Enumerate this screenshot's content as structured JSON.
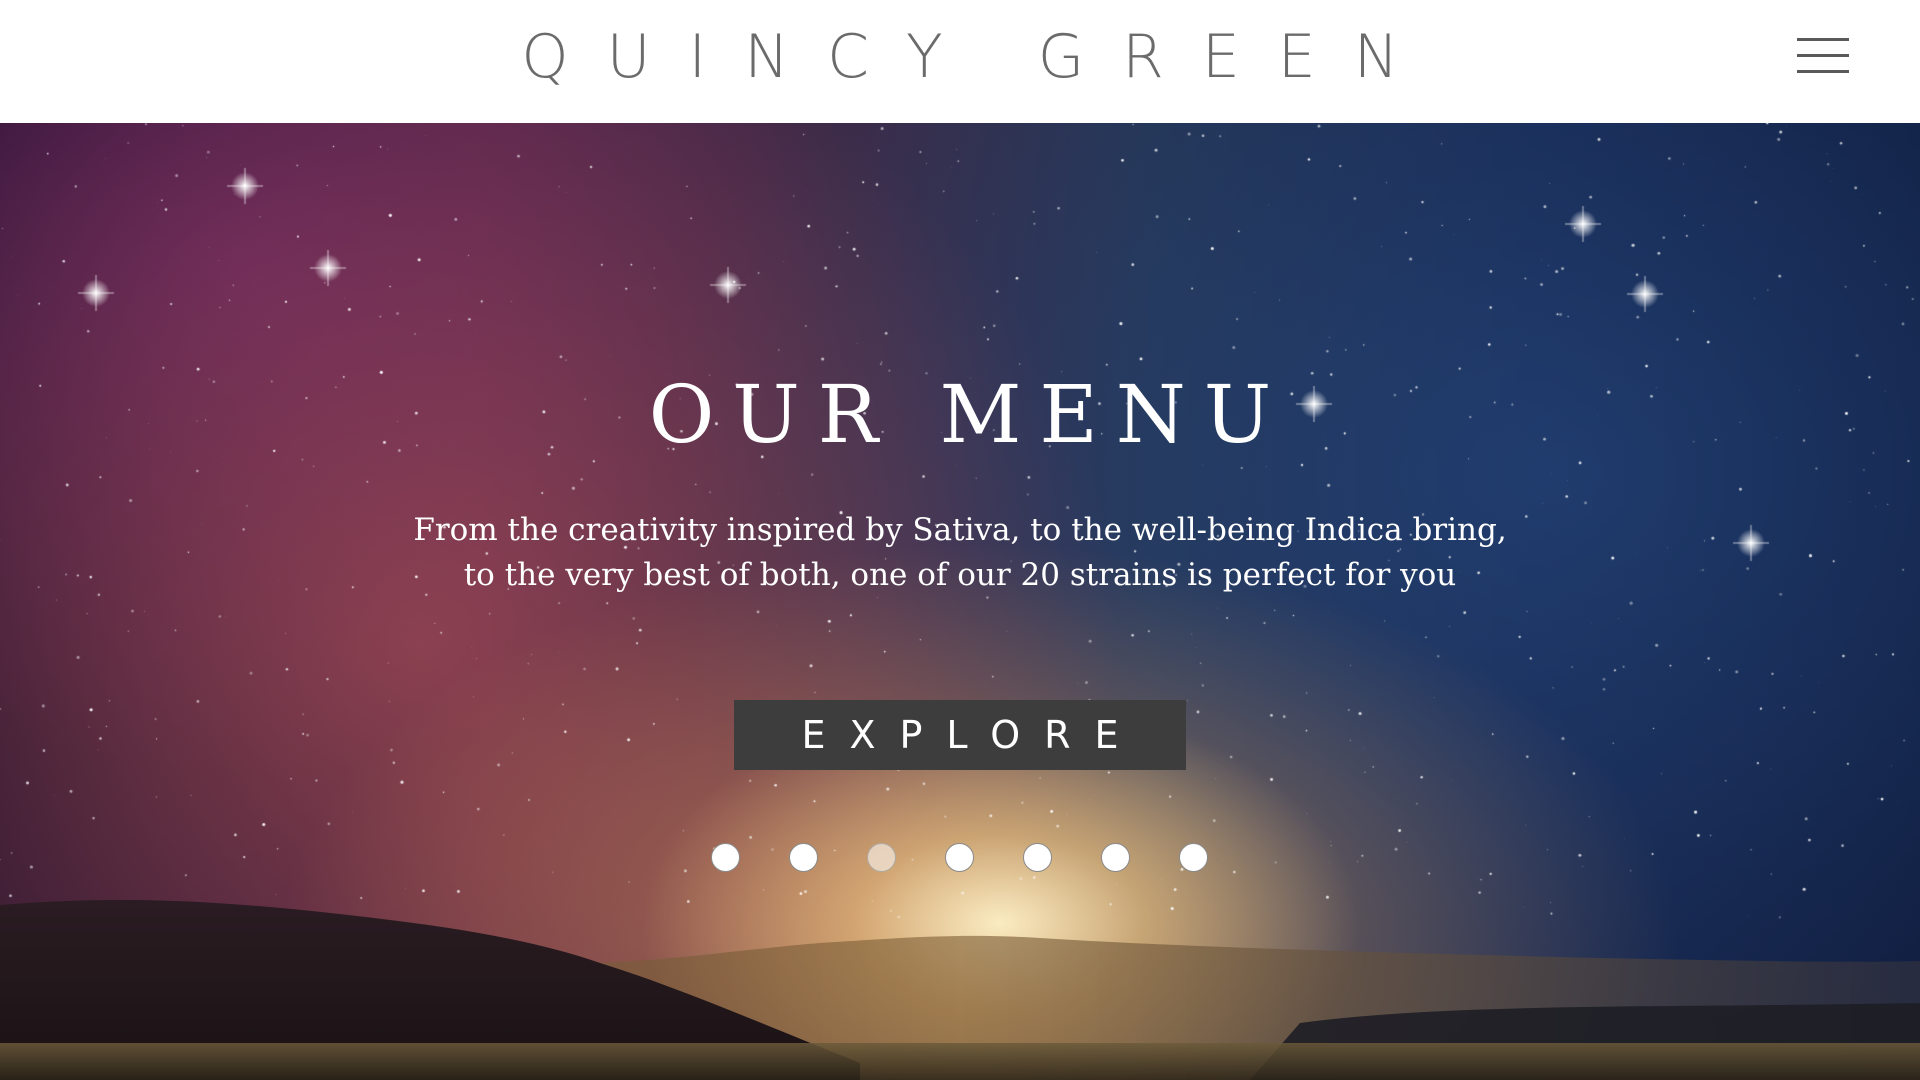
{
  "header": {
    "brand": "QUINCY GREEN",
    "menu_icon": "hamburger-menu-icon"
  },
  "hero": {
    "title": "OUR MENU",
    "subtitle_line1": "From the creativity inspired by Sativa, to the well-being Indica bring,",
    "subtitle_line2": "to the very best of both, one of our 20 strains is perfect for you",
    "cta_label": "EXPLORE",
    "background": "starry-night-sky-over-hills",
    "slider": {
      "total": 7,
      "active_index": 2
    }
  },
  "colors": {
    "header_bg": "#ffffff",
    "brand_text": "#6b6b6b",
    "button_bg": "#3d3d3d",
    "hero_text": "#ffffff"
  }
}
